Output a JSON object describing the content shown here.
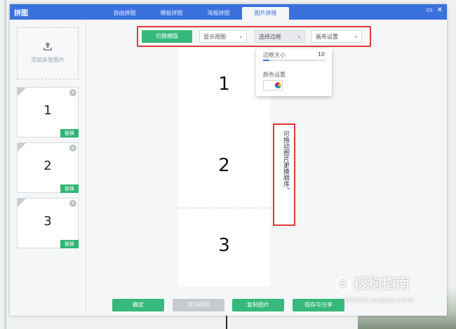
{
  "app": {
    "title": "拼图"
  },
  "tabs": [
    {
      "label": "自由拼图"
    },
    {
      "label": "模板拼图"
    },
    {
      "label": "海报拼图"
    },
    {
      "label": "图片拼接"
    }
  ],
  "window_buttons": {
    "maximize": "▭",
    "close": "✕"
  },
  "sidebar": {
    "add_label": "添加多张图片",
    "thumbnails": [
      {
        "label": "1",
        "replace": "替换"
      },
      {
        "label": "2",
        "replace": "替换"
      },
      {
        "label": "3",
        "replace": "替换"
      }
    ]
  },
  "toolbar": {
    "switch_label": "切换横版",
    "view_select": "显示视图",
    "border_select": "选择边框",
    "canvas_select": "画布设置"
  },
  "border_dropdown": {
    "size_label": "边框大小",
    "size_value": "10",
    "size_fraction": 0.1,
    "color_label": "颜色设置"
  },
  "collage": {
    "cells": [
      "1",
      "2",
      "3"
    ]
  },
  "hint": {
    "text": "可拖动图片更换顺序。"
  },
  "footer": {
    "confirm": "确定",
    "cancel": "取消拼图",
    "copy": "复制图片",
    "save": "保存与分享"
  },
  "watermark": {
    "brand": "搜狗指南",
    "url": "zhinan.sogou.com"
  },
  "colors": {
    "title_bar": "#3a71dd",
    "accent_green": "#36b97b",
    "highlight_red": "#e53935"
  }
}
